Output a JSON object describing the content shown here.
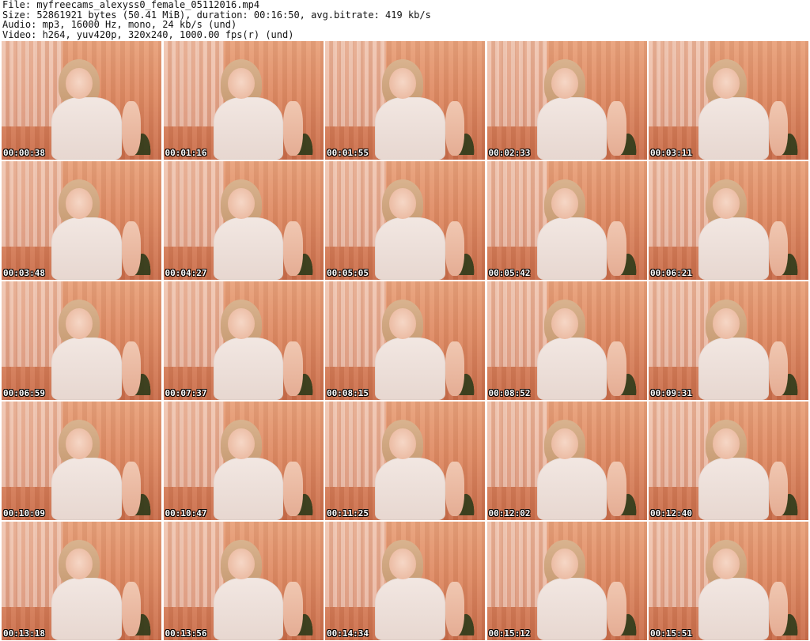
{
  "header": {
    "file": "File: myfreecams_alexyss0_female_05112016.mp4",
    "size": "Size: 52861921 bytes (50.41 MiB), duration: 00:16:50, avg.bitrate: 419 kb/s",
    "audio": "Audio: mp3, 16000 Hz, mono, 24 kb/s (und)",
    "video": "Video: h264, yuv420p, 320x240, 1000.00 fps(r) (und)"
  },
  "thumbnails": [
    {
      "timestamp": "00:00:38"
    },
    {
      "timestamp": "00:01:16"
    },
    {
      "timestamp": "00:01:55"
    },
    {
      "timestamp": "00:02:33"
    },
    {
      "timestamp": "00:03:11"
    },
    {
      "timestamp": "00:03:48"
    },
    {
      "timestamp": "00:04:27"
    },
    {
      "timestamp": "00:05:05"
    },
    {
      "timestamp": "00:05:42"
    },
    {
      "timestamp": "00:06:21"
    },
    {
      "timestamp": "00:06:59"
    },
    {
      "timestamp": "00:07:37"
    },
    {
      "timestamp": "00:08:15"
    },
    {
      "timestamp": "00:08:52"
    },
    {
      "timestamp": "00:09:31"
    },
    {
      "timestamp": "00:10:09"
    },
    {
      "timestamp": "00:10:47"
    },
    {
      "timestamp": "00:11:25"
    },
    {
      "timestamp": "00:12:02"
    },
    {
      "timestamp": "00:12:40"
    },
    {
      "timestamp": "00:13:18"
    },
    {
      "timestamp": "00:13:56"
    },
    {
      "timestamp": "00:14:34"
    },
    {
      "timestamp": "00:15:12"
    },
    {
      "timestamp": "00:15:51"
    }
  ]
}
